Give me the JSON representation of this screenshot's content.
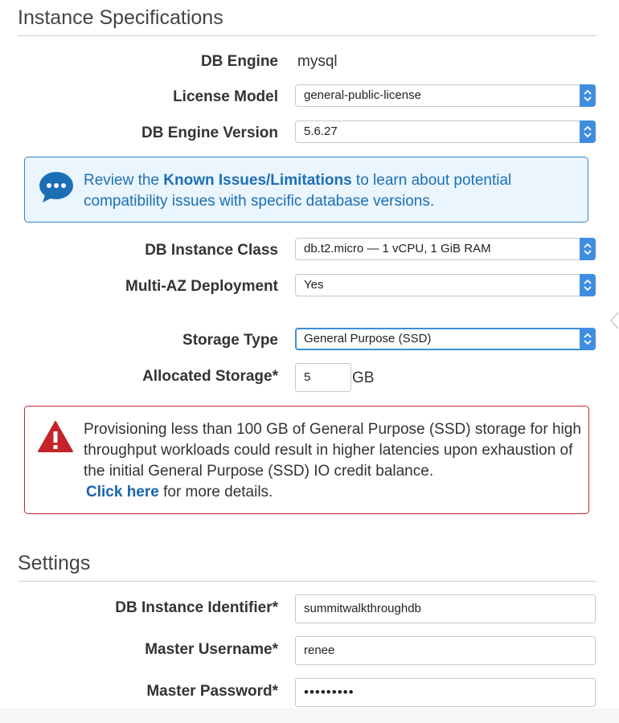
{
  "instance_specs": {
    "title": "Instance Specifications",
    "db_engine": {
      "label": "DB Engine",
      "value": "mysql"
    },
    "license_model": {
      "label": "License Model",
      "value": "general-public-license"
    },
    "db_engine_version": {
      "label": "DB Engine Version",
      "value": "5.6.27"
    },
    "info_notice": {
      "prefix": "Review the ",
      "link": "Known Issues/Limitations",
      "suffix": " to learn about potential compatibility issues with specific database versions."
    },
    "db_instance_class": {
      "label": "DB Instance Class",
      "value": "db.t2.micro — 1 vCPU, 1 GiB RAM"
    },
    "multi_az": {
      "label": "Multi-AZ Deployment",
      "value": "Yes"
    },
    "storage_type": {
      "label": "Storage Type",
      "value": "General Purpose (SSD)"
    },
    "allocated_storage": {
      "label": "Allocated Storage*",
      "value": "5",
      "unit": "GB"
    },
    "warning": {
      "text": "Provisioning less than 100 GB of General Purpose (SSD) storage for high throughput workloads could result in higher latencies upon exhaustion of the initial General Purpose (SSD) IO credit balance.",
      "link": "Click here",
      "suffix": " for more details."
    }
  },
  "settings": {
    "title": "Settings",
    "db_instance_identifier": {
      "label": "DB Instance Identifier*",
      "value": "summitwalkthroughdb"
    },
    "master_username": {
      "label": "Master Username*",
      "value": "renee"
    },
    "master_password": {
      "label": "Master Password*",
      "value": "•••••••••"
    }
  },
  "colors": {
    "accent": "#3f8de0",
    "info_border": "#2c86c7",
    "info_bg": "#eaf5fd",
    "warning_border": "#c5232c",
    "link": "#1864ad"
  }
}
